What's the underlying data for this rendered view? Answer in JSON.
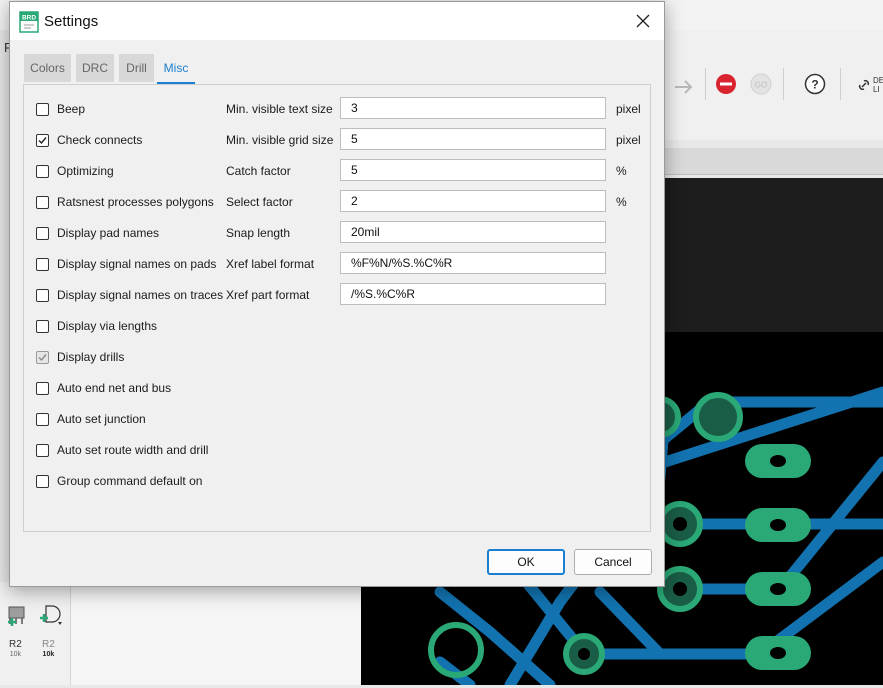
{
  "dialog": {
    "title": "Settings",
    "app_icon_text": "BRD",
    "tabs": [
      {
        "label": "Colors",
        "active": false
      },
      {
        "label": "DRC",
        "active": false
      },
      {
        "label": "Drill",
        "active": false
      },
      {
        "label": "Misc",
        "active": true
      }
    ],
    "checkboxes": [
      {
        "label": "Beep",
        "checked": false,
        "enabled": true
      },
      {
        "label": "Check connects",
        "checked": true,
        "enabled": true
      },
      {
        "label": "Optimizing",
        "checked": false,
        "enabled": true
      },
      {
        "label": "Ratsnest processes polygons",
        "checked": false,
        "enabled": true
      },
      {
        "label": "Display pad names",
        "checked": false,
        "enabled": true
      },
      {
        "label": "Display signal names on pads",
        "checked": false,
        "enabled": true
      },
      {
        "label": "Display signal names on traces",
        "checked": false,
        "enabled": true
      },
      {
        "label": "Display via lengths",
        "checked": false,
        "enabled": true
      },
      {
        "label": "Display drills",
        "checked": true,
        "enabled": false
      },
      {
        "label": "Auto end net and bus",
        "checked": false,
        "enabled": true
      },
      {
        "label": "Auto set junction",
        "checked": false,
        "enabled": true
      },
      {
        "label": "Auto set route width and drill",
        "checked": false,
        "enabled": true
      },
      {
        "label": "Group command default on",
        "checked": false,
        "enabled": true
      }
    ],
    "fields": [
      {
        "label": "Min. visible text size",
        "value": "3",
        "unit": "pixel"
      },
      {
        "label": "Min. visible grid size",
        "value": "5",
        "unit": "pixel"
      },
      {
        "label": "Catch factor",
        "value": "5",
        "unit": "%"
      },
      {
        "label": "Select factor",
        "value": "2",
        "unit": "%"
      },
      {
        "label": "Snap length",
        "value": "20mil",
        "unit": ""
      },
      {
        "label": "Xref label format",
        "value": "%F%N/%S.%C%R",
        "unit": ""
      },
      {
        "label": "Xref part format",
        "value": "/%S.%C%R",
        "unit": ""
      }
    ],
    "buttons": {
      "ok": "OK",
      "cancel": "Cancel"
    }
  },
  "background": {
    "menu_glyph": "F",
    "toolbar_link_text": "DE LI",
    "left_tools": [
      {
        "ref": "R2",
        "value": "10k"
      },
      {
        "ref": "R2",
        "value": "10k"
      }
    ]
  },
  "colors": {
    "accent": "#1a7fd1",
    "trace_blue": "#1273b0",
    "pad_green": "#2aa876",
    "stop_red": "#d9242f",
    "canvas": "#000000"
  }
}
